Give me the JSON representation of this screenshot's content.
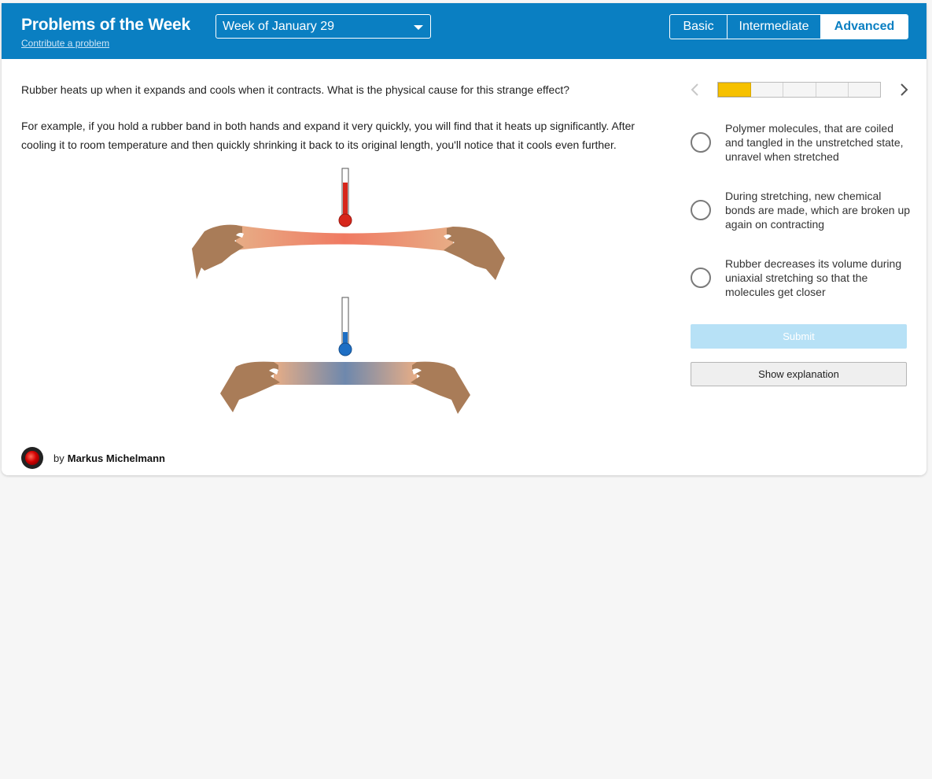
{
  "header": {
    "title": "Problems of the Week",
    "contribute_link": "Contribute a problem",
    "week_select": "Week of January 29",
    "levels": [
      "Basic",
      "Intermediate",
      "Advanced"
    ],
    "selected_level": "Advanced"
  },
  "problem": {
    "question": "Rubber heats up when it expands and cools when it contracts. What is the physical cause for this strange effect?",
    "example": "For example, if you hold a rubber band in both hands and expand it very quickly, you will find that it heats up significantly. After cooling it to room temperature and then quickly shrinking it back to its original length, you'll notice that it cools even further."
  },
  "progress": {
    "total_problems": 5,
    "current_problem": 1
  },
  "options": [
    "Polymer molecules, that are coiled and tangled in the unstretched state, unravel when stretched",
    "During stretching, new chemical bonds are made, which are broken up again on contracting",
    "Rubber decreases its volume during uniaxial stretching so that the molecules get closer"
  ],
  "buttons": {
    "submit": "Submit",
    "explain": "Show explanation"
  },
  "author": {
    "prefix": "by",
    "name": "Markus Michelmann"
  },
  "colors": {
    "header_blue": "#0a7fc2",
    "progress_yellow": "#f6c100",
    "submit_disabled": "#b7e1f6",
    "hot_red": "#d7261b",
    "cold_blue": "#1e6fc4",
    "skin": "#a97c58"
  }
}
